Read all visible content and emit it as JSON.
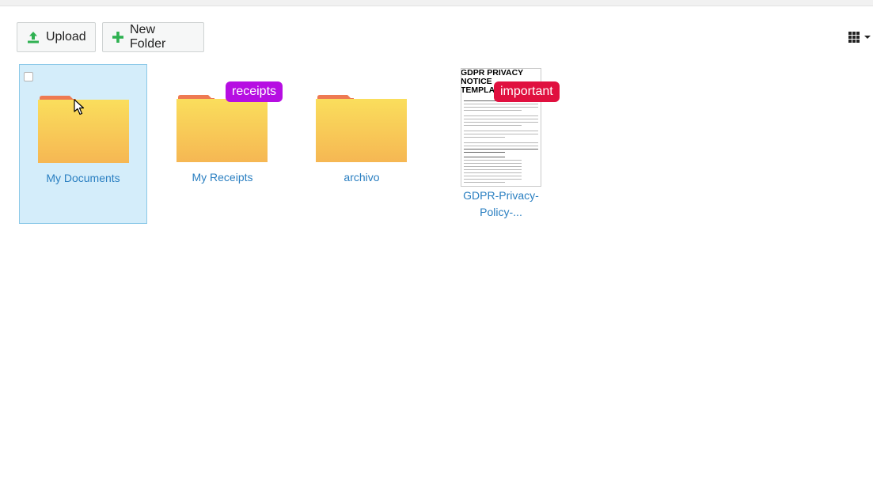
{
  "toolbar": {
    "upload_label": "Upload",
    "new_folder_label": "New Folder"
  },
  "colors": {
    "upload_icon": "#2eb151",
    "new_folder_icon": "#2eb151",
    "selection_bg": "#d4edfa",
    "link_text": "#2a7fc1",
    "tag_receipts": "#b60ee2",
    "tag_important": "#e0103f",
    "folder_body": "#f8c85a",
    "folder_back": "#ee7a52"
  },
  "items": [
    {
      "name": "My Documents",
      "type": "folder",
      "selected": true,
      "tag": ""
    },
    {
      "name": "My Receipts",
      "type": "folder",
      "selected": false,
      "tag": "receipts"
    },
    {
      "name": "archivo",
      "type": "folder",
      "selected": false,
      "tag": ""
    },
    {
      "name": "GDPR-Privacy-Policy-...",
      "type": "document",
      "selected": false,
      "tag": "important"
    }
  ],
  "document_preview": {
    "title": "GDPR PRIVACY NOTICE TEMPLATE"
  },
  "icons": {
    "upload": "upload-icon",
    "new_folder": "plus-icon",
    "view_toggle": "grid-view-icon",
    "caret": "chevron-down-icon",
    "folder": "folder-icon",
    "document": "document-thumbnail",
    "cursor": "mouse-pointer-icon"
  }
}
